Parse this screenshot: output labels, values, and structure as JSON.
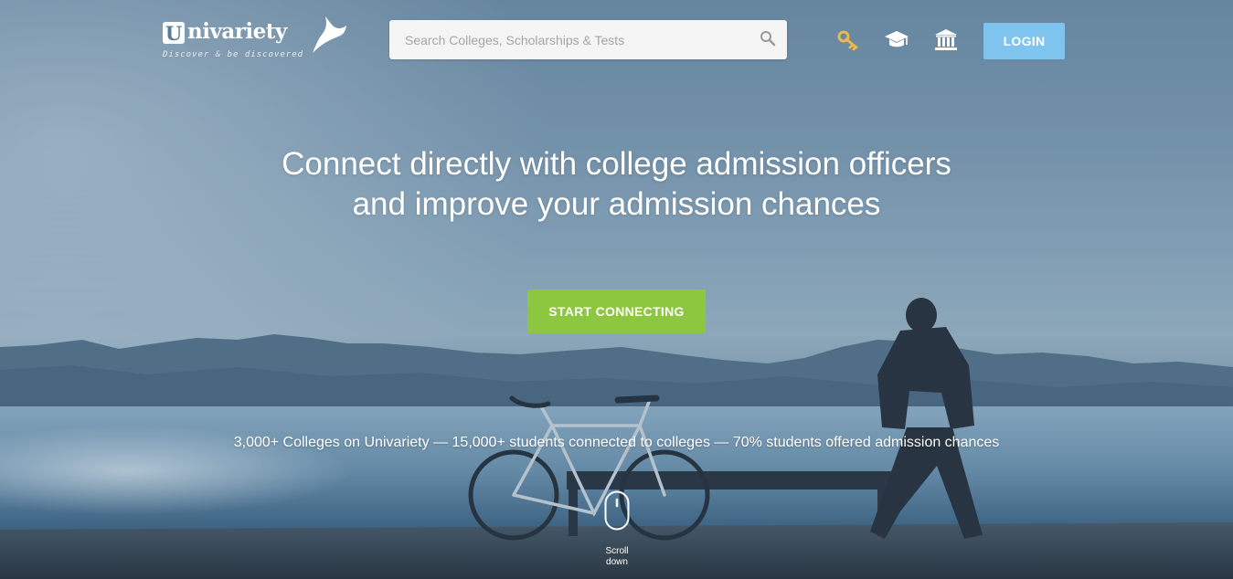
{
  "brand": {
    "initial": "U",
    "name": "nivariety",
    "tagline": "Discover & be discovered"
  },
  "search": {
    "placeholder": "Search Colleges, Scholarships & Tests",
    "value": ""
  },
  "nav": {
    "icons": [
      "key-icon",
      "graduation-cap-icon",
      "institution-icon"
    ],
    "login_label": "LOGIN"
  },
  "hero": {
    "headline_line1": "Connect directly with college admission officers",
    "headline_line2": "and improve your admission chances",
    "cta_label": "START CONNECTING",
    "stats": "3,000+ Colleges on Univariety — 15,000+ students connected to colleges — 70% students offered admission chances",
    "scroll_line1": "Scroll",
    "scroll_line2": "down"
  },
  "colors": {
    "login_bg": "#7ec4ee",
    "cta_bg": "#8dc63f",
    "key_icon": "#e9b949"
  }
}
